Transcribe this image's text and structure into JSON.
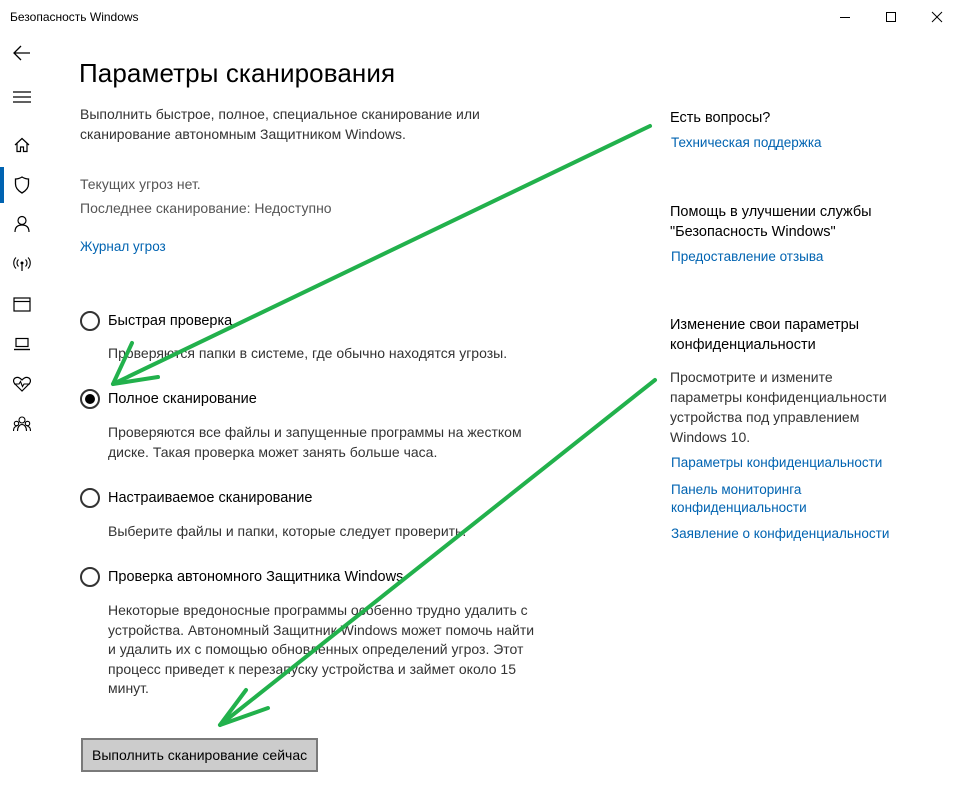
{
  "window": {
    "title": "Безопасность Windows",
    "buttons": {
      "minimize": "minimize-icon",
      "maximize": "maximize-icon",
      "close": "close-icon"
    }
  },
  "sidebar": {
    "items": [
      {
        "icon": "back-arrow-icon"
      },
      {
        "icon": "hamburger-menu-icon"
      },
      {
        "icon": "home-icon"
      },
      {
        "icon": "shield-icon",
        "active": true
      },
      {
        "icon": "account-icon"
      },
      {
        "icon": "network-icon"
      },
      {
        "icon": "app-browser-icon"
      },
      {
        "icon": "laptop-icon"
      },
      {
        "icon": "heart-pulse-icon"
      },
      {
        "icon": "family-icon"
      }
    ]
  },
  "main": {
    "title": "Параметры сканирования",
    "description_line1": "Выполнить быстрое, полное, специальное сканирование или",
    "description_line2": "сканирование автономным Защитником Windows.",
    "status_threats": "Текущих угроз нет.",
    "status_last_scan": "Последнее сканирование: Недоступно",
    "threat_history_link": "Журнал угроз",
    "options": [
      {
        "label": "Быстрая проверка",
        "checked": false,
        "desc": [
          "Проверяются папки в системе, где обычно находятся угрозы."
        ]
      },
      {
        "label": "Полное сканирование",
        "checked": true,
        "desc": [
          "Проверяются все файлы и запущенные программы на жестком",
          "диске. Такая проверка может занять больше часа."
        ]
      },
      {
        "label": "Настраиваемое сканирование",
        "checked": false,
        "desc": [
          "Выберите файлы и папки, которые следует проверить."
        ]
      },
      {
        "label": "Проверка автономного Защитника Windows",
        "checked": false,
        "desc": [
          "Некоторые вредоносные программы особенно трудно удалить с",
          "устройства. Автономный Защитник Windows может помочь найти",
          "и удалить их с помощью обновленных определений угроз. Этот",
          "процесс приведет к перезапуску устройства и займет около 15",
          "минут."
        ]
      }
    ],
    "scan_button": "Выполнить сканирование сейчас"
  },
  "right_panel": {
    "questions_heading": "Есть вопросы?",
    "support_link": "Техническая поддержка",
    "improve_heading_line1": "Помощь в улучшении службы",
    "improve_heading_line2": "\"Безопасность Windows\"",
    "feedback_link": "Предоставление отзыва",
    "privacy_heading_line1": "Изменение свои параметры",
    "privacy_heading_line2": "конфиденциальности",
    "privacy_text": [
      "Просмотрите и измените",
      "параметры конфиденциальности",
      "устройства под управлением",
      "Windows 10."
    ],
    "privacy_settings_link": "Параметры конфиденциальности",
    "privacy_dashboard_link_line1": "Панель мониторинга",
    "privacy_dashboard_link_line2": "конфиденциальности",
    "privacy_statement_link": "Заявление о конфиденциальности"
  },
  "colors": {
    "accent": "#0063b1",
    "annotation_arrow": "#22b14c",
    "button_bg": "#cccccc"
  }
}
